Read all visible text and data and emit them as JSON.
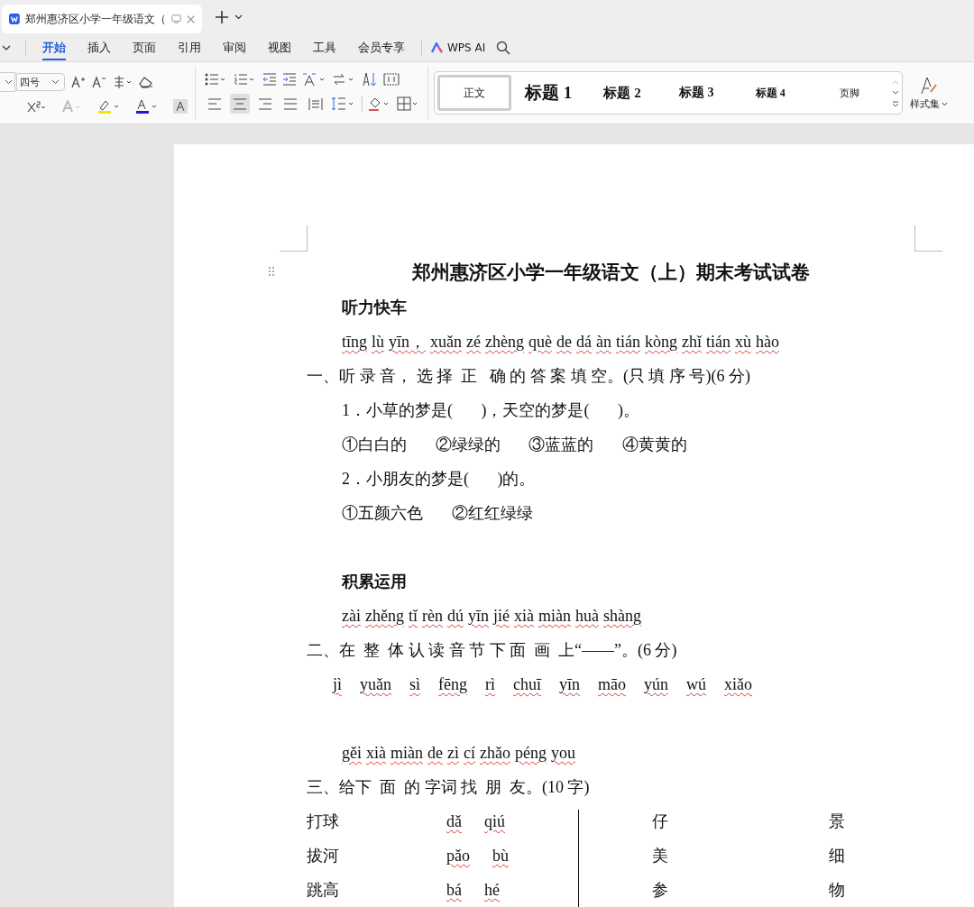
{
  "doc_tab": {
    "title": "郑州惠济区小学一年级语文（",
    "selected": true
  },
  "ribbon_tabs": [
    {
      "label": "开始",
      "selected": true
    },
    {
      "label": "插入",
      "selected": false
    },
    {
      "label": "页面",
      "selected": false
    },
    {
      "label": "引用",
      "selected": false
    },
    {
      "label": "审阅",
      "selected": false
    },
    {
      "label": "视图",
      "selected": false
    },
    {
      "label": "工具",
      "selected": false
    },
    {
      "label": "会员专享",
      "selected": false
    }
  ],
  "ai_button": "WPS AI",
  "font_size": "四号",
  "alignment_buttons": [
    {
      "kind": "left",
      "selected": false
    },
    {
      "kind": "center",
      "selected": true
    },
    {
      "kind": "right",
      "selected": false
    },
    {
      "kind": "justify",
      "selected": false
    },
    {
      "kind": "distributed",
      "selected": false
    }
  ],
  "styles": [
    {
      "label": "正文",
      "kind": "body",
      "selected": true
    },
    {
      "label": "标题 1",
      "kind": "h1",
      "selected": false
    },
    {
      "label": "标题 2",
      "kind": "h2",
      "selected": false
    },
    {
      "label": "标题 3",
      "kind": "h3",
      "selected": false
    },
    {
      "label": "标题 4",
      "kind": "h4",
      "selected": false
    },
    {
      "label": "页脚",
      "kind": "footer",
      "selected": false
    }
  ],
  "style_set": "样式集",
  "document": {
    "title": "郑州惠济区小学一年级语文（上）期末考试试卷",
    "blocks": [
      {
        "kind": "heading",
        "text": "听力快车"
      },
      {
        "kind": "pinyin",
        "words": [
          "tīng",
          "lù",
          "yīn，",
          "xuǎn",
          "zé",
          "zhèng",
          "què",
          "de",
          "dá",
          "àn",
          "tián",
          "kòng",
          "zhǐ",
          "tián",
          "xù",
          "hào"
        ]
      },
      {
        "kind": "question",
        "text": "一、听 录 音， 选 择  正   确 的 答 案 填 空。(只 填 序 号)(6 分)"
      },
      {
        "kind": "line",
        "text": "1．小草的梦是(       )，天空的梦是(       )。"
      },
      {
        "kind": "line",
        "text": "①白白的       ②绿绿的       ③蓝蓝的       ④黄黄的"
      },
      {
        "kind": "line",
        "text": "2．小朋友的梦是(       )的。"
      },
      {
        "kind": "line",
        "text": "①五颜六色       ②红红绿绿"
      },
      {
        "kind": "gap"
      },
      {
        "kind": "heading",
        "text": "积累运用"
      },
      {
        "kind": "pinyin",
        "words": [
          "zài",
          "zhěng",
          "tǐ",
          "rèn",
          "dú",
          "yīn",
          "jié",
          "xià",
          "miàn",
          "huà",
          "shàng"
        ]
      },
      {
        "kind": "question",
        "text": "二、在  整  体 认 读 音 节 下 面  画  上“——”。(6 分)"
      },
      {
        "kind": "spaced_pinyin",
        "words": [
          "jì",
          "yuǎn",
          "sì",
          "fēng",
          "rì",
          "chuī",
          "yīn",
          "māo",
          "yún",
          "wú",
          "xiǎo"
        ]
      },
      {
        "kind": "gap"
      },
      {
        "kind": "pinyin",
        "words": [
          "gěi",
          "xià",
          "miàn",
          "de",
          "zì",
          "cí",
          "zhǎo",
          "péng",
          "you"
        ]
      },
      {
        "kind": "question",
        "text": "三、给下  面  的 字词 找  朋  友。(10 字)"
      }
    ],
    "table": [
      {
        "word": "打球",
        "pinyin": [
          "dǎ",
          "qiú"
        ],
        "char_a": "仔",
        "char_b": "景"
      },
      {
        "word": "拔河",
        "pinyin": [
          "pǎo",
          "bù"
        ],
        "char_a": "美",
        "char_b": "细"
      },
      {
        "word": "跳高",
        "pinyin": [
          "bá",
          "hé"
        ],
        "char_a": "参",
        "char_b": "物"
      }
    ]
  }
}
